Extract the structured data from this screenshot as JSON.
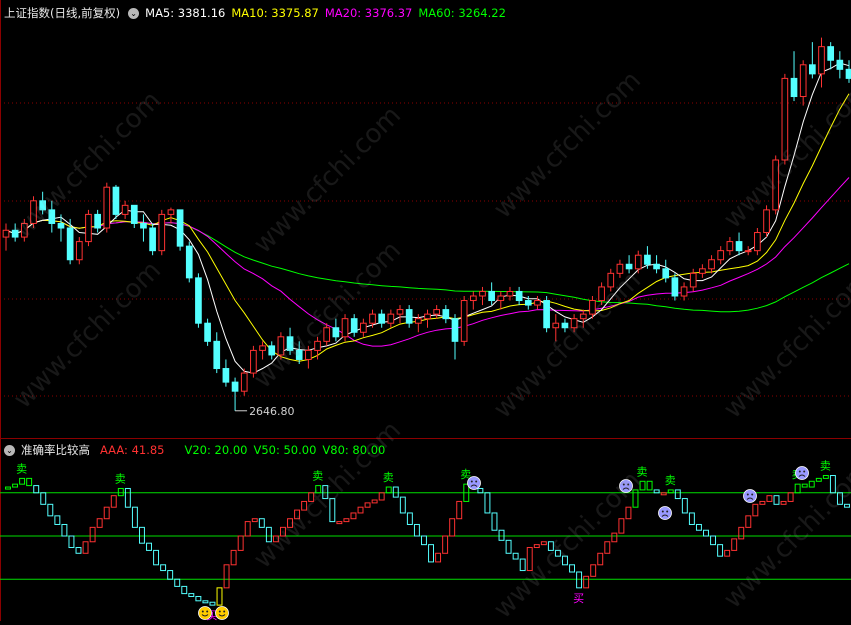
{
  "main_header": {
    "title": "上证指数(日线,前复权)",
    "dropdown_icon": "chevron-down-icon",
    "ma5": "MA5: 3381.16",
    "ma10": "MA10: 3375.87",
    "ma20": "MA20: 3376.37",
    "ma60": "MA60: 3264.22"
  },
  "sub_header": {
    "title": "准确率比较高",
    "dropdown_icon": "chevron-down-icon",
    "aaa": "AAA: 41.85",
    "v20": "V20: 20.00",
    "v50": "V50: 50.00",
    "v80": "V80: 80.00"
  },
  "watermark": "www.cfchi.com",
  "colors": {
    "background": "#000000",
    "up": "#ff3232",
    "down": "#54ffff",
    "ma5": "#ffffff",
    "ma10": "#ffff00",
    "ma20": "#ff00ff",
    "ma60": "#00ff00",
    "frame": "#8b0000",
    "grid": "#8b0000",
    "indicator_line": "#00dd00",
    "sell_label": "#00ff00",
    "buy_label": "#ff00ff",
    "smiley": "#ffcc00",
    "sad_face": "#9999ff"
  },
  "chart_data": [
    {
      "type": "candlestick",
      "title": "上证指数(日线,前复权)",
      "ohlc": [
        [
          3030,
          3060,
          3000,
          3045
        ],
        [
          3045,
          3060,
          3020,
          3030
        ],
        [
          3030,
          3070,
          3020,
          3060
        ],
        [
          3060,
          3120,
          3050,
          3110
        ],
        [
          3110,
          3130,
          3080,
          3090
        ],
        [
          3090,
          3110,
          3040,
          3060
        ],
        [
          3060,
          3080,
          3020,
          3050
        ],
        [
          3050,
          3070,
          2970,
          2980
        ],
        [
          2980,
          3030,
          2970,
          3020
        ],
        [
          3020,
          3090,
          3010,
          3080
        ],
        [
          3080,
          3090,
          3040,
          3050
        ],
        [
          3050,
          3150,
          3040,
          3140
        ],
        [
          3140,
          3145,
          3070,
          3080
        ],
        [
          3080,
          3110,
          3070,
          3100
        ],
        [
          3100,
          3100,
          3050,
          3060
        ],
        [
          3060,
          3080,
          3020,
          3050
        ],
        [
          3050,
          3060,
          2990,
          3000
        ],
        [
          3000,
          3090,
          2990,
          3080
        ],
        [
          3080,
          3095,
          3060,
          3090
        ],
        [
          3090,
          3090,
          3000,
          3010
        ],
        [
          3010,
          3020,
          2930,
          2940
        ],
        [
          2940,
          2950,
          2830,
          2840
        ],
        [
          2840,
          2850,
          2790,
          2800
        ],
        [
          2800,
          2820,
          2730,
          2740
        ],
        [
          2740,
          2760,
          2700,
          2710
        ],
        [
          2710,
          2720,
          2646.8,
          2690
        ],
        [
          2690,
          2740,
          2680,
          2730
        ],
        [
          2730,
          2790,
          2720,
          2780
        ],
        [
          2780,
          2800,
          2760,
          2790
        ],
        [
          2790,
          2800,
          2760,
          2770
        ],
        [
          2770,
          2820,
          2760,
          2810
        ],
        [
          2810,
          2830,
          2770,
          2780
        ],
        [
          2780,
          2800,
          2750,
          2760
        ],
        [
          2760,
          2790,
          2740,
          2780
        ],
        [
          2780,
          2810,
          2760,
          2800
        ],
        [
          2800,
          2840,
          2790,
          2830
        ],
        [
          2830,
          2850,
          2800,
          2810
        ],
        [
          2810,
          2860,
          2800,
          2850
        ],
        [
          2850,
          2860,
          2810,
          2820
        ],
        [
          2820,
          2850,
          2810,
          2840
        ],
        [
          2840,
          2870,
          2830,
          2860
        ],
        [
          2860,
          2870,
          2830,
          2840
        ],
        [
          2840,
          2870,
          2830,
          2860
        ],
        [
          2860,
          2880,
          2840,
          2870
        ],
        [
          2870,
          2880,
          2830,
          2840
        ],
        [
          2840,
          2860,
          2820,
          2850
        ],
        [
          2850,
          2870,
          2830,
          2860
        ],
        [
          2860,
          2880,
          2850,
          2870
        ],
        [
          2870,
          2880,
          2840,
          2850
        ],
        [
          2850,
          2860,
          2760,
          2800
        ],
        [
          2800,
          2900,
          2790,
          2890
        ],
        [
          2890,
          2910,
          2870,
          2900
        ],
        [
          2900,
          2920,
          2880,
          2910
        ],
        [
          2910,
          2930,
          2880,
          2890
        ],
        [
          2890,
          2910,
          2870,
          2900
        ],
        [
          2900,
          2920,
          2890,
          2910
        ],
        [
          2910,
          2920,
          2880,
          2890
        ],
        [
          2890,
          2900,
          2870,
          2880
        ],
        [
          2880,
          2900,
          2870,
          2890
        ],
        [
          2890,
          2900,
          2820,
          2830
        ],
        [
          2830,
          2860,
          2800,
          2840
        ],
        [
          2840,
          2850,
          2820,
          2830
        ],
        [
          2830,
          2860,
          2820,
          2850
        ],
        [
          2850,
          2870,
          2830,
          2860
        ],
        [
          2860,
          2900,
          2850,
          2890
        ],
        [
          2890,
          2930,
          2880,
          2920
        ],
        [
          2920,
          2960,
          2910,
          2950
        ],
        [
          2950,
          2980,
          2940,
          2970
        ],
        [
          2970,
          2990,
          2950,
          2960
        ],
        [
          2960,
          3000,
          2950,
          2990
        ],
        [
          2990,
          3010,
          2960,
          2970
        ],
        [
          2970,
          2990,
          2950,
          2960
        ],
        [
          2960,
          2980,
          2930,
          2940
        ],
        [
          2940,
          2950,
          2890,
          2900
        ],
        [
          2900,
          2930,
          2890,
          2920
        ],
        [
          2920,
          2960,
          2910,
          2950
        ],
        [
          2950,
          2970,
          2940,
          2960
        ],
        [
          2960,
          2990,
          2950,
          2980
        ],
        [
          2980,
          3010,
          2970,
          3000
        ],
        [
          3000,
          3030,
          2990,
          3020
        ],
        [
          3020,
          3040,
          2990,
          3000
        ],
        [
          3000,
          3010,
          2990,
          3000
        ],
        [
          3000,
          3050,
          2990,
          3040
        ],
        [
          3040,
          3100,
          3030,
          3090
        ],
        [
          3090,
          3210,
          3080,
          3200
        ],
        [
          3200,
          3390,
          3190,
          3380
        ],
        [
          3380,
          3440,
          3330,
          3340
        ],
        [
          3340,
          3420,
          3320,
          3410
        ],
        [
          3410,
          3460,
          3380,
          3390
        ],
        [
          3390,
          3470,
          3360,
          3450
        ],
        [
          3450,
          3460,
          3400,
          3420
        ],
        [
          3420,
          3440,
          3380,
          3400
        ],
        [
          3400,
          3420,
          3370,
          3380
        ]
      ],
      "annotations": [
        "2646.80"
      ],
      "ma_values": {
        "MA5": 3381.16,
        "MA10": 3375.87,
        "MA20": 3376.37,
        "MA60": 3264.22
      }
    },
    {
      "type": "step",
      "title": "准确率比较高",
      "series": [
        {
          "name": "AAA",
          "values": [
            84,
            86,
            90,
            85,
            80,
            72,
            64,
            58,
            50,
            42,
            38,
            46,
            56,
            62,
            70,
            78,
            83,
            70,
            56,
            45,
            40,
            30,
            26,
            20,
            15,
            10,
            8,
            5,
            4,
            2,
            14,
            30,
            40,
            50,
            60,
            62,
            56,
            46,
            50,
            56,
            62,
            68,
            74,
            80,
            85,
            76,
            60,
            60,
            62,
            66,
            70,
            73,
            75,
            80,
            84,
            77,
            66,
            58,
            50,
            44,
            32,
            38,
            50,
            62,
            74,
            86,
            83,
            80,
            66,
            54,
            47,
            38,
            34,
            26,
            42,
            44,
            46,
            40,
            36,
            30,
            25,
            14,
            22,
            30,
            38,
            46,
            52,
            62,
            70,
            82,
            88,
            82,
            80,
            80,
            82,
            76,
            66,
            58,
            54,
            50,
            44,
            36,
            40,
            48,
            56,
            64,
            72,
            74,
            78,
            72,
            74,
            80,
            86,
            84,
            88,
            90,
            92,
            80,
            72,
            70
          ]
        }
      ],
      "reference_lines": [
        20,
        50,
        80
      ],
      "current_value": 41.85,
      "signal_labels": {
        "sell": "卖",
        "buy": "买"
      }
    }
  ]
}
